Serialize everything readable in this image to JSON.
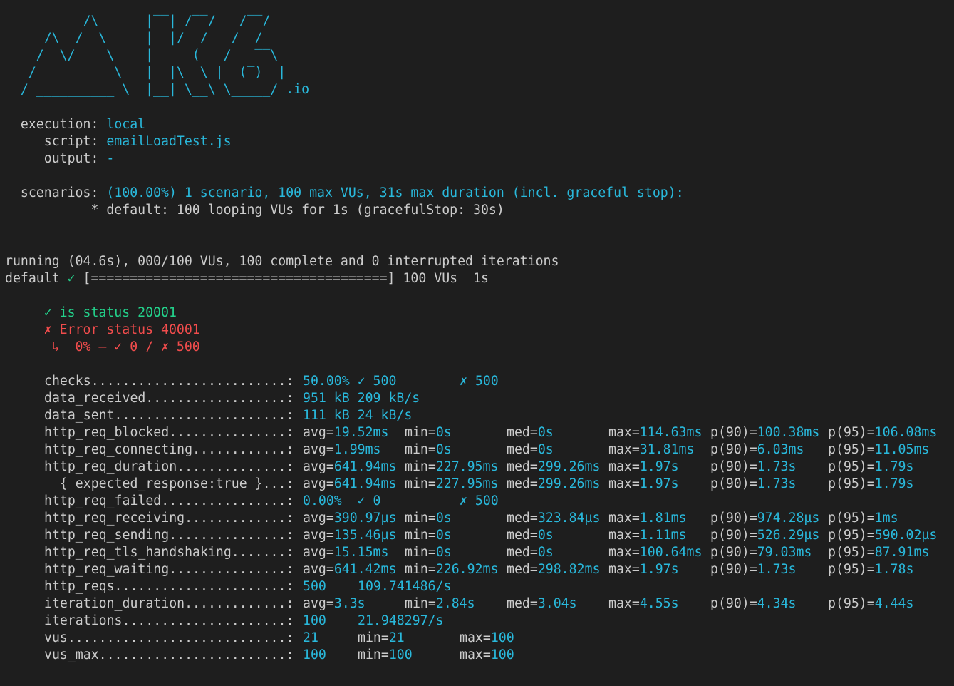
{
  "logo": {
    "lines": [
      "          /\\      |‾‾| /‾‾/   /‾‾/",
      "     /\\  /  \\     |  |/  /   /  /",
      "    /  \\/    \\    |     (   /   ‾‾\\",
      "   /          \\   |  |\\  \\ |  (‾)  |",
      "  / __________ \\  |__| \\__\\ \\_____/ "
    ],
    "suffix": ".io"
  },
  "execution": {
    "label": "execution",
    "value": "local"
  },
  "script": {
    "label": "script",
    "value": "emailLoadTest.js"
  },
  "output": {
    "label": "output",
    "value": "-"
  },
  "scenarios": {
    "label": "scenarios",
    "summary": "(100.00%) 1 scenario, 100 max VUs, 31s max duration (incl. graceful stop):",
    "default_line": "* default: 100 looping VUs for 1s (gracefulStop: 30s)"
  },
  "run": {
    "status_line": "running (04.6s), 000/100 VUs, 100 complete and 0 interrupted iterations",
    "default_label": "default",
    "check_mark": "✓",
    "progress_bar": "[======================================]",
    "vus": "100 VUs",
    "duration": "1s",
    "progress": 1.0
  },
  "checks": [
    {
      "mark": "✓",
      "text": "is status 20001",
      "status": "pass"
    },
    {
      "mark": "✗",
      "text": "Error status 40001",
      "status": "fail"
    }
  ],
  "check_detail": "↳  0% — ✓ 0 / ✗ 500",
  "metrics": [
    {
      "name": "checks.........................:",
      "cols": [
        "50.00% ✓ 500",
        "",
        "✗ 500"
      ]
    },
    {
      "name": "data_received..................:",
      "cols": [
        "951 kB 209 kB/s"
      ]
    },
    {
      "name": "data_sent......................:",
      "cols": [
        "111 kB 24 kB/s"
      ]
    },
    {
      "name": "http_req_blocked...............:",
      "cols": [
        "avg=19.52ms",
        "min=0s",
        "med=0s",
        "max=114.63ms",
        "p(90)=100.38ms",
        "p(95)=106.08ms"
      ]
    },
    {
      "name": "http_req_connecting............:",
      "cols": [
        "avg=1.99ms",
        "min=0s",
        "med=0s",
        "max=31.81ms",
        "p(90)=6.03ms",
        "p(95)=11.05ms"
      ]
    },
    {
      "name": "http_req_duration..............:",
      "cols": [
        "avg=641.94ms",
        "min=227.95ms",
        "med=299.26ms",
        "max=1.97s",
        "p(90)=1.73s",
        "p(95)=1.79s"
      ]
    },
    {
      "name": "  { expected_response:true }...:",
      "cols": [
        "avg=641.94ms",
        "min=227.95ms",
        "med=299.26ms",
        "max=1.97s",
        "p(90)=1.73s",
        "p(95)=1.79s"
      ]
    },
    {
      "name": "http_req_failed................:",
      "cols": [
        "0.00%  ✓ 0",
        "",
        "✗ 500"
      ]
    },
    {
      "name": "http_req_receiving.............:",
      "cols": [
        "avg=390.97µs",
        "min=0s",
        "med=323.84µs",
        "max=1.81ms",
        "p(90)=974.28µs",
        "p(95)=1ms"
      ]
    },
    {
      "name": "http_req_sending...............:",
      "cols": [
        "avg=135.46µs",
        "min=0s",
        "med=0s",
        "max=1.11ms",
        "p(90)=526.29µs",
        "p(95)=590.02µs"
      ]
    },
    {
      "name": "http_req_tls_handshaking.......:",
      "cols": [
        "avg=15.15ms",
        "min=0s",
        "med=0s",
        "max=100.64ms",
        "p(90)=79.03ms",
        "p(95)=87.91ms"
      ]
    },
    {
      "name": "http_req_waiting...............:",
      "cols": [
        "avg=641.42ms",
        "min=226.92ms",
        "med=298.82ms",
        "max=1.97s",
        "p(90)=1.73s",
        "p(95)=1.78s"
      ]
    },
    {
      "name": "http_reqs......................:",
      "cols": [
        "500",
        "109.741486/s"
      ]
    },
    {
      "name": "iteration_duration.............:",
      "cols": [
        "avg=3.3s",
        "min=2.84s",
        "med=3.04s",
        "max=4.55s",
        "p(90)=4.34s",
        "p(95)=4.44s"
      ]
    },
    {
      "name": "iterations.....................:",
      "cols": [
        "100",
        "21.948297/s"
      ]
    },
    {
      "name": "vus............................:",
      "cols": [
        "21",
        "min=21",
        "max=100"
      ]
    },
    {
      "name": "vus_max........................:",
      "cols": [
        "100",
        "min=100",
        "max=100"
      ]
    }
  ],
  "colors": {
    "background": "#1e1e1e",
    "text": "#cccccc",
    "accent": "#29b8db",
    "pass": "#23d18b",
    "fail": "#f14c4c"
  }
}
